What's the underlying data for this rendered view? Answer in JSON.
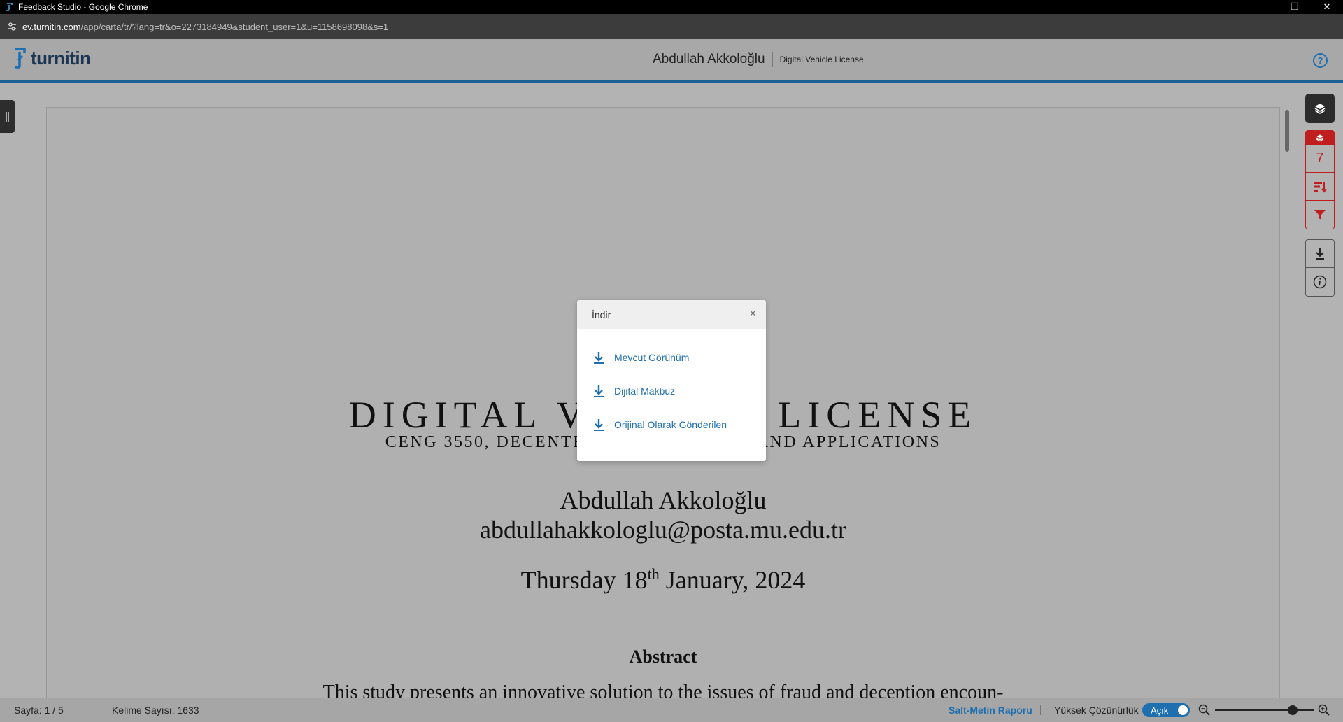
{
  "window": {
    "title": "Feedback Studio - Google Chrome",
    "minimize_glyph": "—",
    "restore_glyph": "❐",
    "close_glyph": "✕"
  },
  "address": {
    "host": "ev.turnitin.com",
    "path": "/app/carta/tr/?lang=tr&o=2273184949&student_user=1&u=1158698098&s=1"
  },
  "header": {
    "logo_text": "turnitin",
    "student_name": "Abdullah Akkoloğlu",
    "assignment": "Digital Vehicle License",
    "help_glyph": "?"
  },
  "document": {
    "title": "DIGITAL VEHICLE LICENSE",
    "subtitle": "CENG 3550, DECENTRALIZED SYSTEMS AND APPLICATIONS",
    "author": "Abdullah Akkoloğlu",
    "email": "abdullahakkologlu@posta.mu.edu.tr",
    "date_before": "Thursday 18",
    "date_sup": "th",
    "date_after": " January, 2024",
    "abstract_title": "Abstract",
    "abstract_text": "This study presents an innovative solution to the issues of fraud and deception encoun-"
  },
  "rail": {
    "similarity_score": "7"
  },
  "status": {
    "page": "Sayfa: 1 / 5",
    "word_count": "Kelime Sayısı: 1633",
    "text_report": "Salt-Metin Raporu",
    "hires_label": "Yüksek Çözünürlük",
    "toggle_label": "Açık",
    "zoom_level": 0.78
  },
  "modal": {
    "title": "İndir",
    "close_glyph": "×",
    "items": [
      {
        "label": "Mevcut Görünüm"
      },
      {
        "label": "Dijital Makbuz"
      },
      {
        "label": "Orijinal Olarak Gönderilen"
      }
    ]
  },
  "colors": {
    "accent": "#1d6fb0",
    "similarity": "#c01e1e",
    "header_rule": "#1b5f93"
  }
}
